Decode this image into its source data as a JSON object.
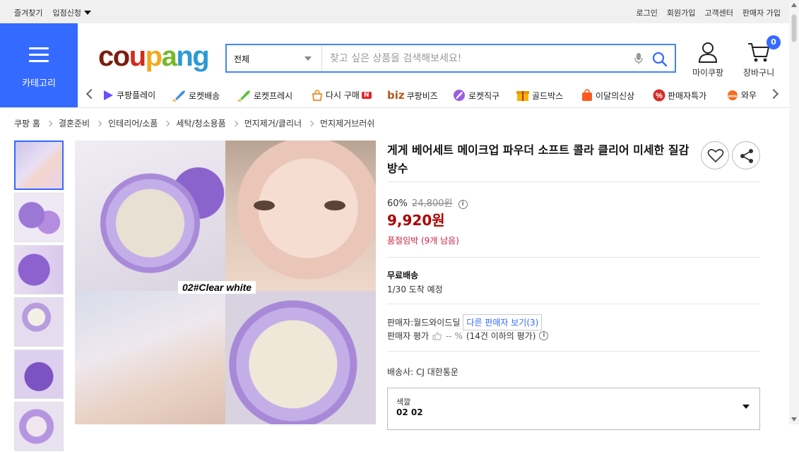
{
  "topbar": {
    "favorites": "즐겨찾기",
    "store_apply": "입점신청",
    "links": [
      "로그인",
      "회원가입",
      "고객센터",
      "판매자 가입"
    ]
  },
  "category": {
    "label": "카테고리"
  },
  "logo": {
    "text": "coupang",
    "letters": [
      "c",
      "o",
      "u",
      "p",
      "a",
      "n",
      "g"
    ],
    "letter_colors": [
      "#7c1d0e",
      "#7c1d0e",
      "#d52b1e",
      "#f2a91e",
      "#76b82a",
      "#2b9ad3",
      "#2b9ad3"
    ]
  },
  "search": {
    "category": "전체",
    "placeholder": "찾고 싶은 상품을 검색해보세요!",
    "accent": "#4285f4"
  },
  "header_icons": {
    "mypage": "마이쿠팡",
    "cart": "장바구니",
    "cart_count": "0"
  },
  "subnav": [
    {
      "label": "쿠팡플레이",
      "icon": "play-icon"
    },
    {
      "label": "로켓배송",
      "icon": "rocket-icon"
    },
    {
      "label": "로켓프레시",
      "icon": "rocket-fresh-icon"
    },
    {
      "label": "다시 구매",
      "icon": "rebuy-icon",
      "badge": "N"
    },
    {
      "label": "쿠팡비즈",
      "icon": "biz-icon",
      "prefix": "biz"
    },
    {
      "label": "로켓직구",
      "icon": "rocket-global-icon"
    },
    {
      "label": "골드박스",
      "icon": "goldbox-icon"
    },
    {
      "label": "이달의신상",
      "icon": "new-bag-icon"
    },
    {
      "label": "판매자특가",
      "icon": "percent-icon"
    },
    {
      "label": "와우",
      "icon": "wow-icon"
    }
  ],
  "breadcrumb": [
    "쿠팡 홈",
    "결혼준비",
    "인테리어/소품",
    "세탁/청소용품",
    "먼지제거/클리너",
    "먼지제거브러쉬"
  ],
  "product": {
    "title": "게게 베어세트 메이크업 파우더 소프트 콜라 클리어 미세한 질감 방수",
    "image_tag": "02#Clear white",
    "discount_rate": "60%",
    "original_price": "24,800원",
    "price": "9,920원",
    "stock_notice": "품절임박 (9개 남음)",
    "shipping_type": "무료배송",
    "arrival": "1/30 도착 예정",
    "seller_label": "판매자:",
    "seller_name": "월드와이드딜",
    "other_sellers": "다른 판매자 보기(3)",
    "rating_label": "판매자 평가",
    "rating_value": "-- %",
    "rating_note": "(14건 이하의 평가)",
    "delivery_label": "배송사:",
    "delivery_company": "CJ 대한통운",
    "option_label": "색깔",
    "option_value": "02 02"
  },
  "colors": {
    "brand_blue": "#346aff",
    "price_red": "#ae0000",
    "stock_red": "#cc2244"
  }
}
